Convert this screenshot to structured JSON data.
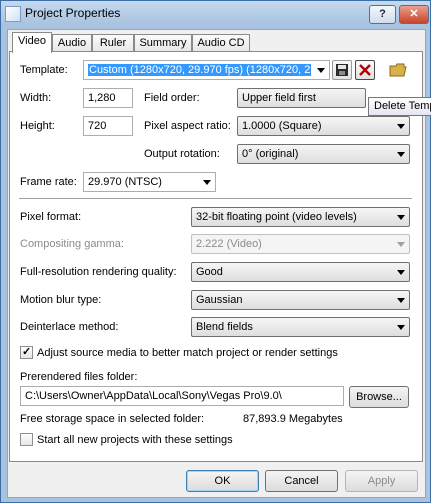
{
  "window": {
    "title": "Project Properties",
    "help_label": "?",
    "close_label": "✕"
  },
  "tabs": [
    {
      "label": "Video",
      "active": true
    },
    {
      "label": "Audio"
    },
    {
      "label": "Ruler"
    },
    {
      "label": "Summary"
    },
    {
      "label": "Audio CD"
    }
  ],
  "template": {
    "label": "Template:",
    "value": "Custom (1280x720, 29.970 fps) (1280x720, 2",
    "icons": [
      "save-icon",
      "delete-icon",
      "folder-icon"
    ],
    "tooltip": "Delete Template"
  },
  "width": {
    "label": "Width:",
    "value": "1,280"
  },
  "height": {
    "label": "Height:",
    "value": "720"
  },
  "field_order": {
    "label": "Field order:",
    "value": "Upper field first"
  },
  "pixel_aspect": {
    "label": "Pixel aspect ratio:",
    "value": "1.0000 (Square)"
  },
  "output_rotation": {
    "label": "Output rotation:",
    "value": "0° (original)"
  },
  "frame_rate": {
    "label": "Frame rate:",
    "value": "29.970 (NTSC)"
  },
  "pixel_format": {
    "label": "Pixel format:",
    "value": "32-bit floating point (video levels)"
  },
  "compositing_gamma": {
    "label": "Compositing gamma:",
    "value": "2.222 (Video)",
    "enabled": false
  },
  "render_quality": {
    "label": "Full-resolution rendering quality:",
    "value": "Good"
  },
  "motion_blur": {
    "label": "Motion blur type:",
    "value": "Gaussian"
  },
  "deinterlace": {
    "label": "Deinterlace method:",
    "value": "Blend fields"
  },
  "adjust_source": {
    "label": "Adjust source media to better match project or render settings",
    "checked": true,
    "mark": "✓"
  },
  "prerendered": {
    "label": "Prerendered files folder:",
    "value": "C:\\Users\\Owner\\AppData\\Local\\Sony\\Vegas Pro\\9.0\\",
    "browse_label": "Browse..."
  },
  "free_storage": {
    "label": "Free storage space in selected folder:",
    "value": "87,893.9 Megabytes"
  },
  "start_all": {
    "label": "Start all new projects with these settings",
    "checked": false
  },
  "buttons": {
    "ok": "OK",
    "cancel": "Cancel",
    "apply": "Apply"
  }
}
